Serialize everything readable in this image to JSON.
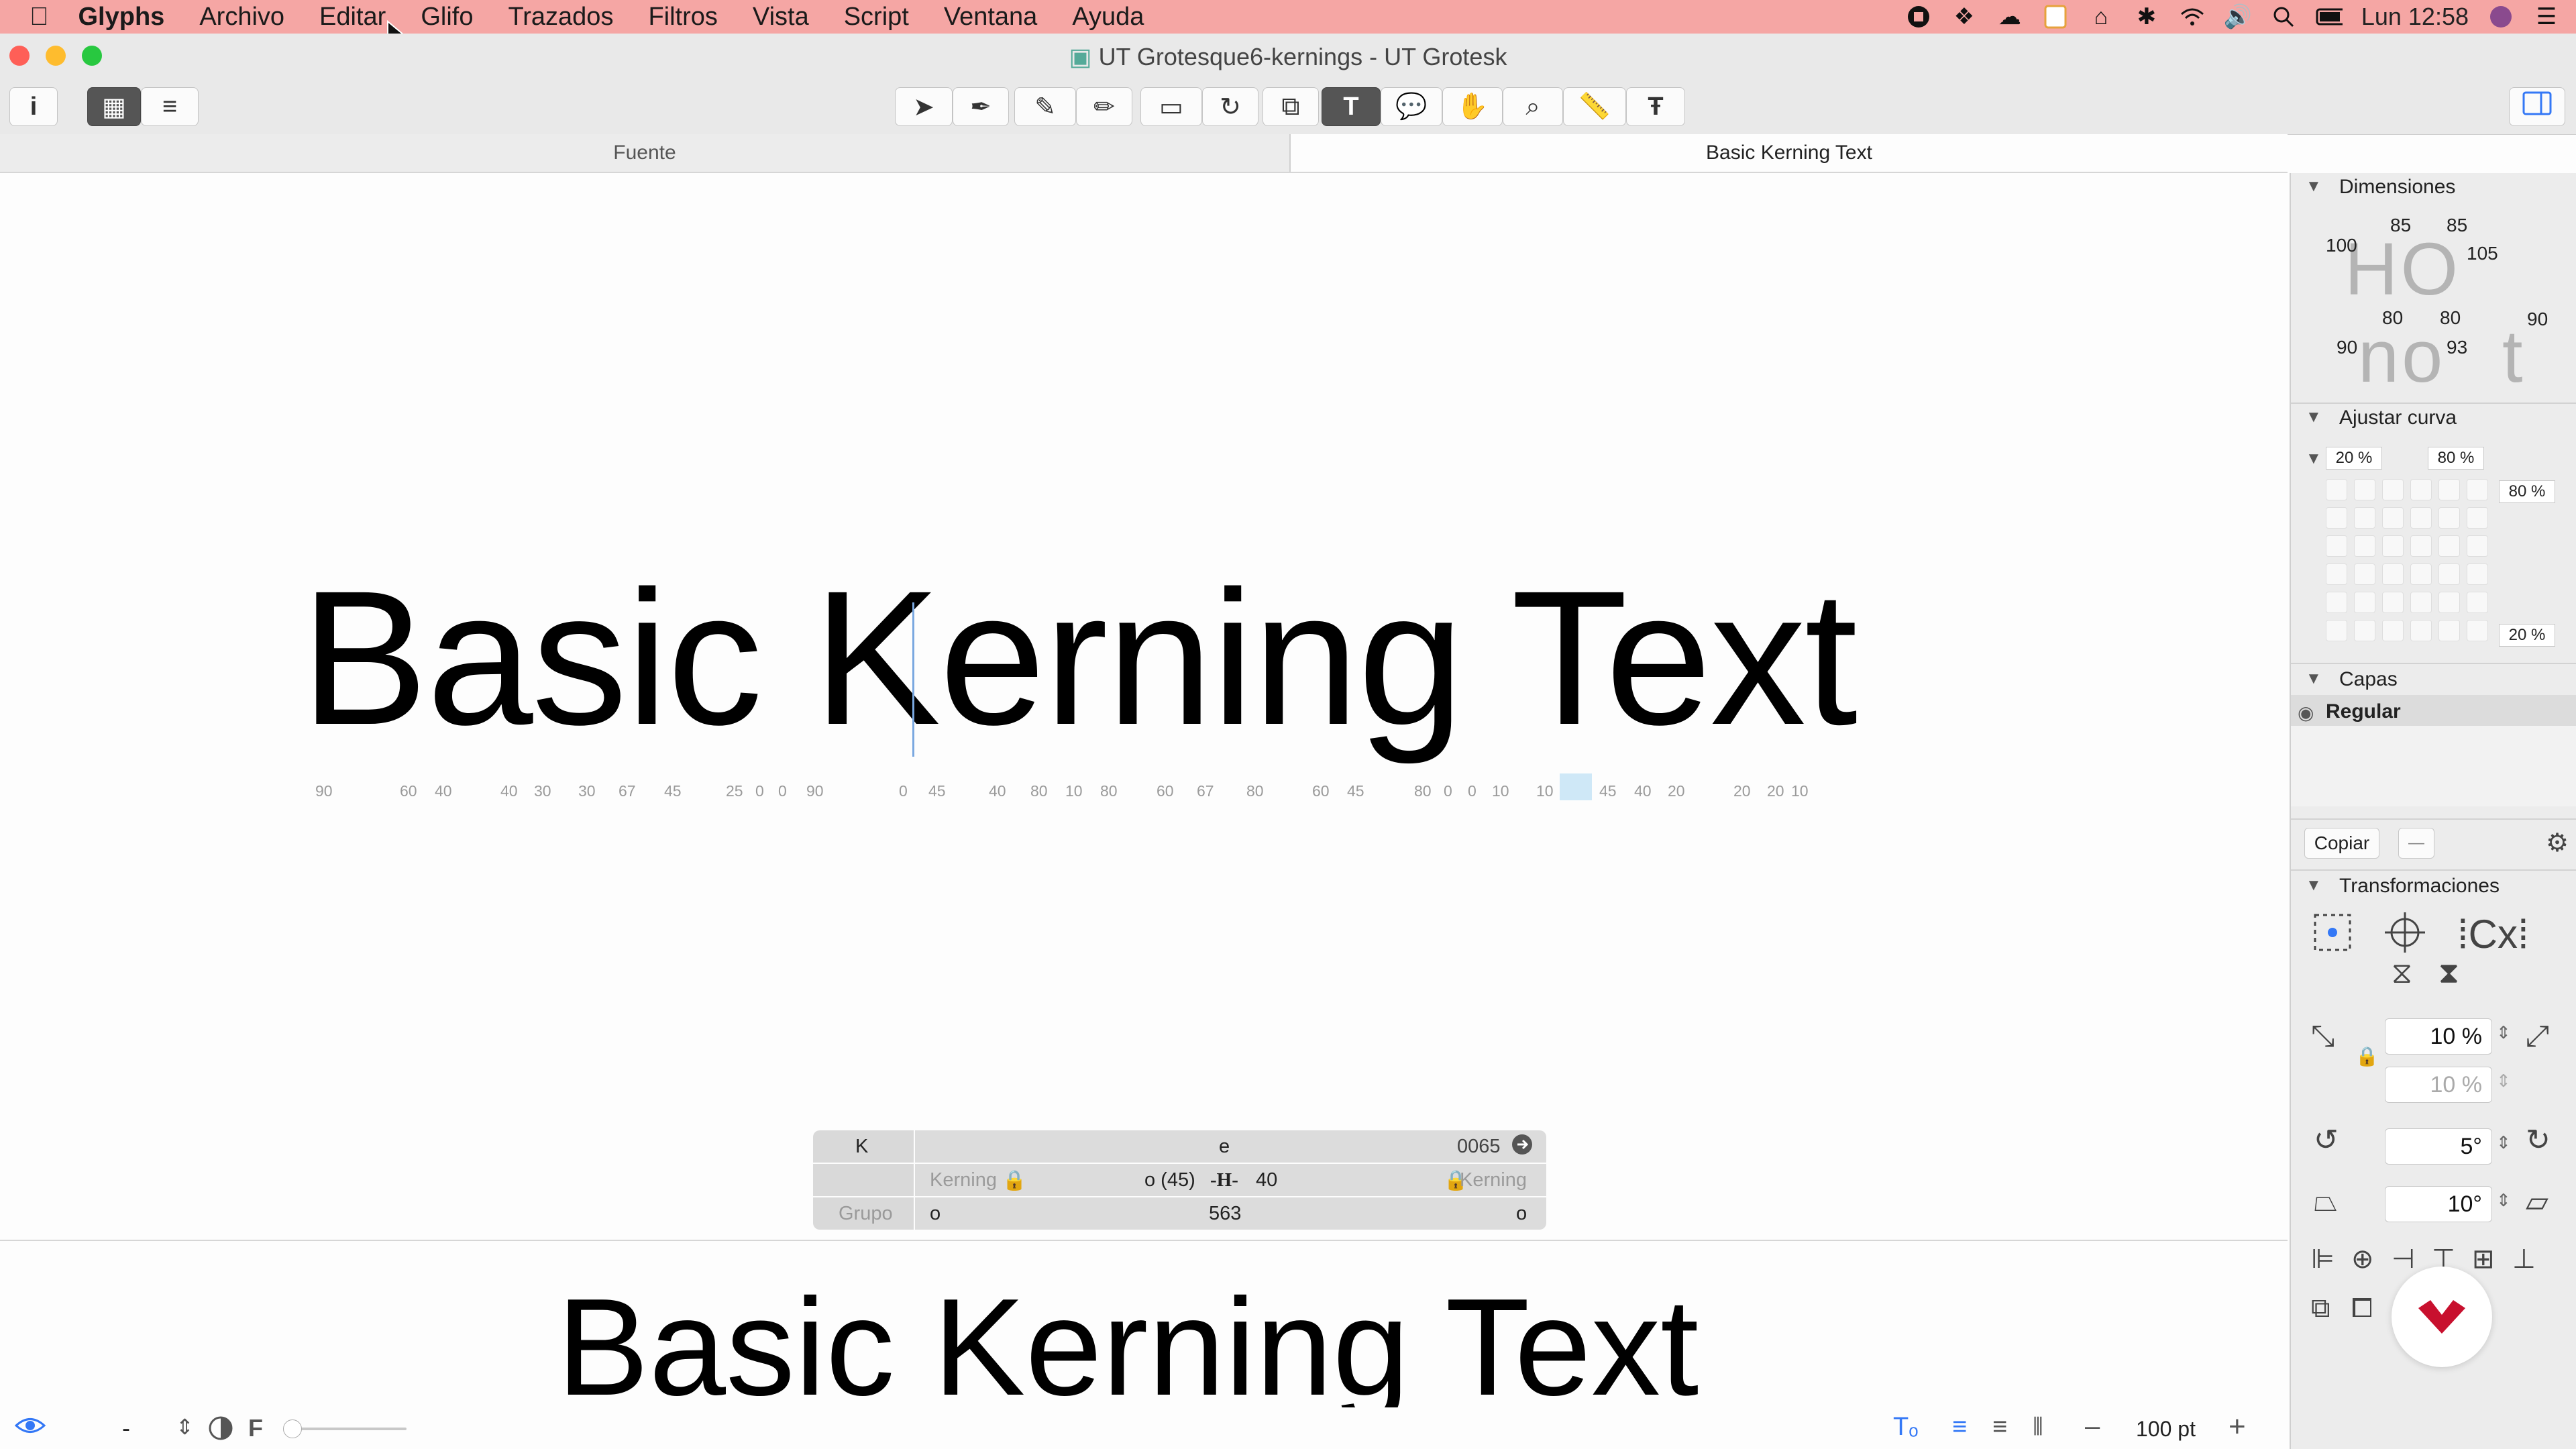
{
  "menubar": {
    "apple": "",
    "items": [
      "Glyphs",
      "Archivo",
      "Editar",
      "Glifo",
      "Trazados",
      "Filtros",
      "Vista",
      "Script",
      "Ventana",
      "Ayuda"
    ],
    "clock": "Lun 12:58"
  },
  "window": {
    "title": "UT Grotesque6-kernings - UT Grotesk"
  },
  "tabs": {
    "left": "Fuente",
    "right": "Basic Kerning Text"
  },
  "canvas": {
    "text": "Basic Kerning Text",
    "sidebearings": [
      "90",
      "60",
      "40",
      "40",
      "30",
      "30",
      "67",
      "45",
      "25",
      "0",
      "0",
      "90",
      "0",
      "45",
      "40",
      "80",
      "10",
      "80",
      "60",
      "67",
      "80",
      "60",
      "45",
      "80",
      "0",
      "0",
      "10",
      "10",
      "45",
      "40",
      "20",
      "20",
      "20",
      "10"
    ]
  },
  "kerning_panel": {
    "left_glyph": "K",
    "right_glyph": "e",
    "unicode": "0065",
    "kerning_label_left": "Kerning",
    "kerning_label_right": "Kerning",
    "left_value": "o (45)",
    "right_value": "40",
    "group_label": "Grupo",
    "group_left": "o",
    "width": "563",
    "group_right": "o"
  },
  "preview": {
    "text": "Basic Kerning Text"
  },
  "bottombar": {
    "minus": "-",
    "f_label": "F",
    "zoom": "100 pt"
  },
  "inspector": {
    "dimensions_title": "Dimensiones",
    "dim_values": [
      "85",
      "85",
      "100",
      "105",
      "80",
      "80",
      "90",
      "90",
      "93"
    ],
    "curve_title": "Ajustar curva",
    "curve_values": [
      "20 %",
      "80 %",
      "80 %",
      "20 %"
    ],
    "layers_title": "Capas",
    "layer_name": "Regular",
    "copy_button": "Copiar",
    "minus_button": "—",
    "transform_title": "Transformaciones",
    "scale_x": "10 %",
    "scale_y": "10 %",
    "rotate": "5°",
    "slant": "10°"
  },
  "colors": {
    "menubar": "#f5a6a4",
    "accent": "#3478f6",
    "logo": "#c8102e"
  }
}
